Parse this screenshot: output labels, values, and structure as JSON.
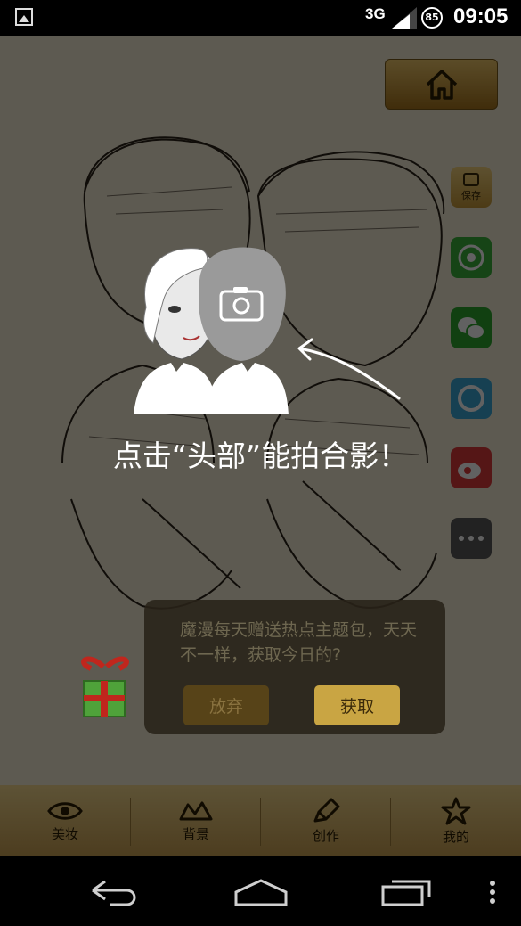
{
  "status_bar": {
    "network": "3G",
    "battery": "85",
    "time": "09:05"
  },
  "side_buttons": {
    "save_label": "保存"
  },
  "hint": {
    "text": "点击“头部”能拍合影！"
  },
  "toast": {
    "message": "魔漫每天赠送热点主题包，天天不一样，获取今日的?",
    "giveup_label": "放弃",
    "get_label": "获取"
  },
  "tabs": [
    {
      "label": "美妆",
      "icon": "eye-icon"
    },
    {
      "label": "背景",
      "icon": "mountain-icon"
    },
    {
      "label": "创作",
      "icon": "pencil-icon"
    },
    {
      "label": "我的",
      "icon": "star-icon"
    }
  ],
  "colors": {
    "accent": "#c9a052",
    "overlay": "rgba(0,0,0,0.62)"
  }
}
